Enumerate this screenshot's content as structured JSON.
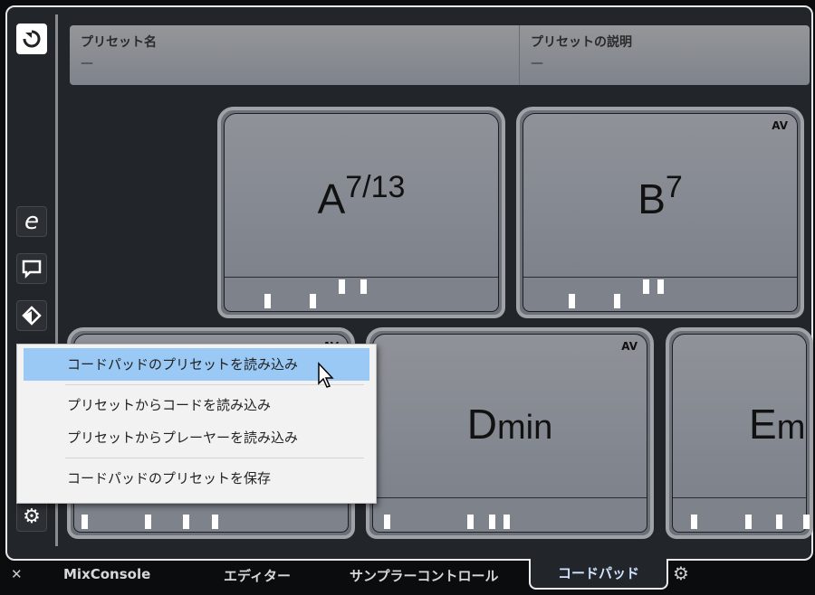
{
  "preset": {
    "name_label": "プリセット名",
    "name_value": "—",
    "desc_label": "プリセットの説明",
    "desc_value": "—"
  },
  "pads": [
    {
      "root": "A",
      "ext": "7/13",
      "badge": ""
    },
    {
      "root": "B",
      "ext": "7",
      "badge": "AV"
    },
    {
      "root": "",
      "ext": "",
      "badge": "AV"
    },
    {
      "root": "D",
      "ext": "min",
      "badge": "AV"
    },
    {
      "root": "E",
      "ext": "m",
      "badge": ""
    }
  ],
  "menu": {
    "items": [
      "コードパッドのプリセットを読み込み",
      "プリセットからコードを読み込み",
      "プリセットからプレーヤーを読み込み",
      "コードパッドのプリセットを保存"
    ]
  },
  "tabs": {
    "close": "✕",
    "items": [
      "MixConsole",
      "エディター",
      "サンプラーコントロール",
      "コードパッド"
    ],
    "active": "コードパッド"
  }
}
